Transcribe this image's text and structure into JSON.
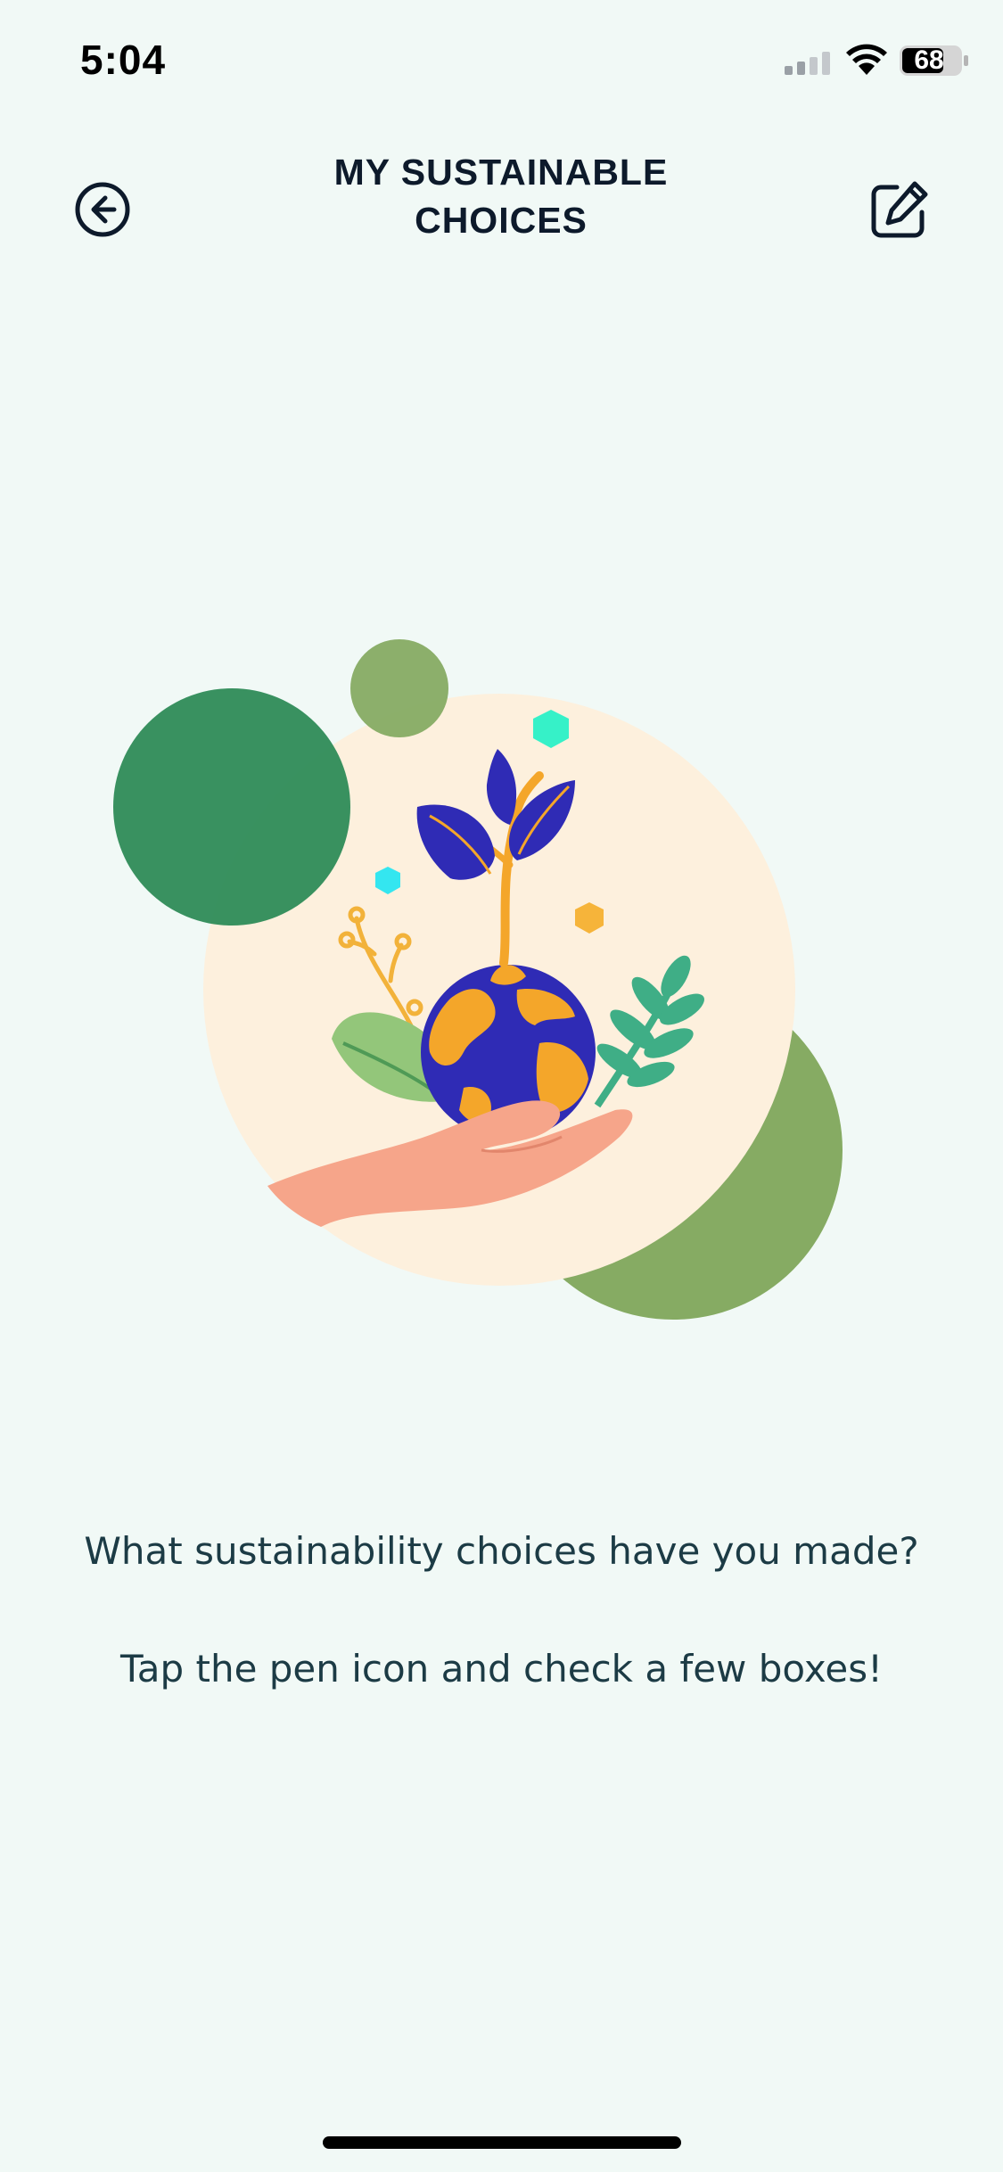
{
  "status_bar": {
    "time": "5:04",
    "battery_level": "68",
    "icons": [
      "signal-icon",
      "wifi-icon",
      "battery-icon"
    ]
  },
  "header": {
    "title": "MY SUSTAINABLE\nCHOICES",
    "back_icon": "back-arrow-circle-icon",
    "edit_icon": "edit-pen-icon"
  },
  "empty_state": {
    "illustration": "hand-holding-earth-with-plant-illustration",
    "prompt": "What sustainability choices have you made?",
    "hint": "Tap the pen icon and check a few boxes!"
  },
  "colors": {
    "background": "#f1f9f6",
    "title_text": "#0d1a2b",
    "body_text": "#1c3b45",
    "dark_green": "#2e8b57",
    "olive_green": "#86ab63",
    "cream": "#fdf0dd",
    "globe_blue": "#2f2bb5",
    "orange": "#f4a62a"
  }
}
